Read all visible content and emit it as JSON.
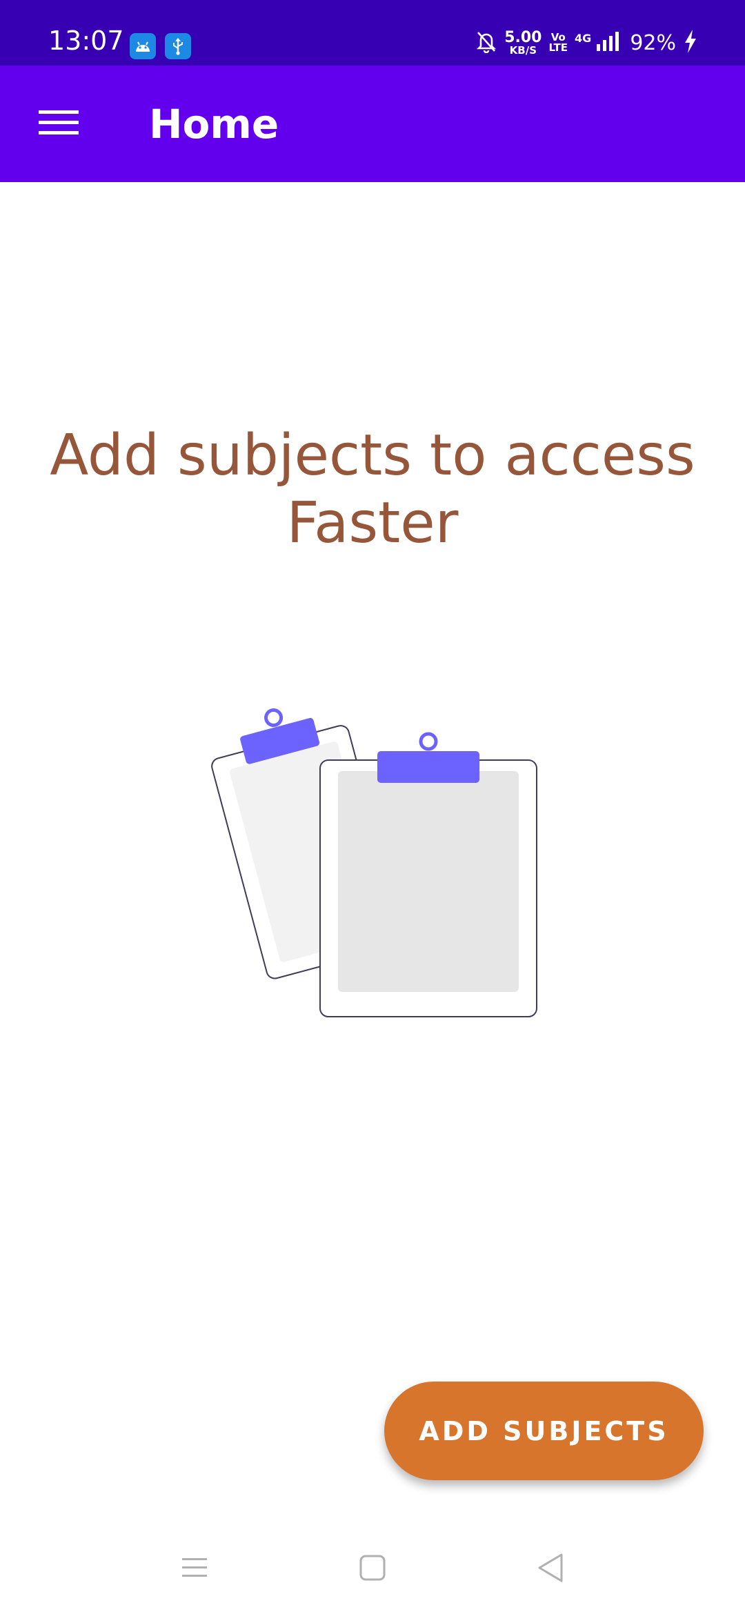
{
  "status_bar": {
    "time": "13:07",
    "speed_value": "5.00",
    "speed_unit": "KB/S",
    "volte_top": "Vo",
    "volte_bottom": "LTE",
    "network": "4G",
    "battery": "92%",
    "icons": [
      "android-debug-icon",
      "usb-icon",
      "bell-off-icon",
      "signal-icon",
      "charging-icon"
    ]
  },
  "app_bar": {
    "title": "Home",
    "menu_icon": "hamburger-menu-icon"
  },
  "main": {
    "empty_message": "Add subjects to access Faster",
    "illustration": "clipboards-illustration"
  },
  "fab": {
    "label": "ADD SUBJECTS"
  },
  "nav_bar": {
    "icons": [
      "recent-apps-icon",
      "home-icon",
      "back-icon"
    ]
  },
  "colors": {
    "status_bar": "#3700b3",
    "app_bar": "#6200ee",
    "message_text": "#96563a",
    "fab": "#d8752d",
    "clip_accent": "#6c63ff"
  }
}
